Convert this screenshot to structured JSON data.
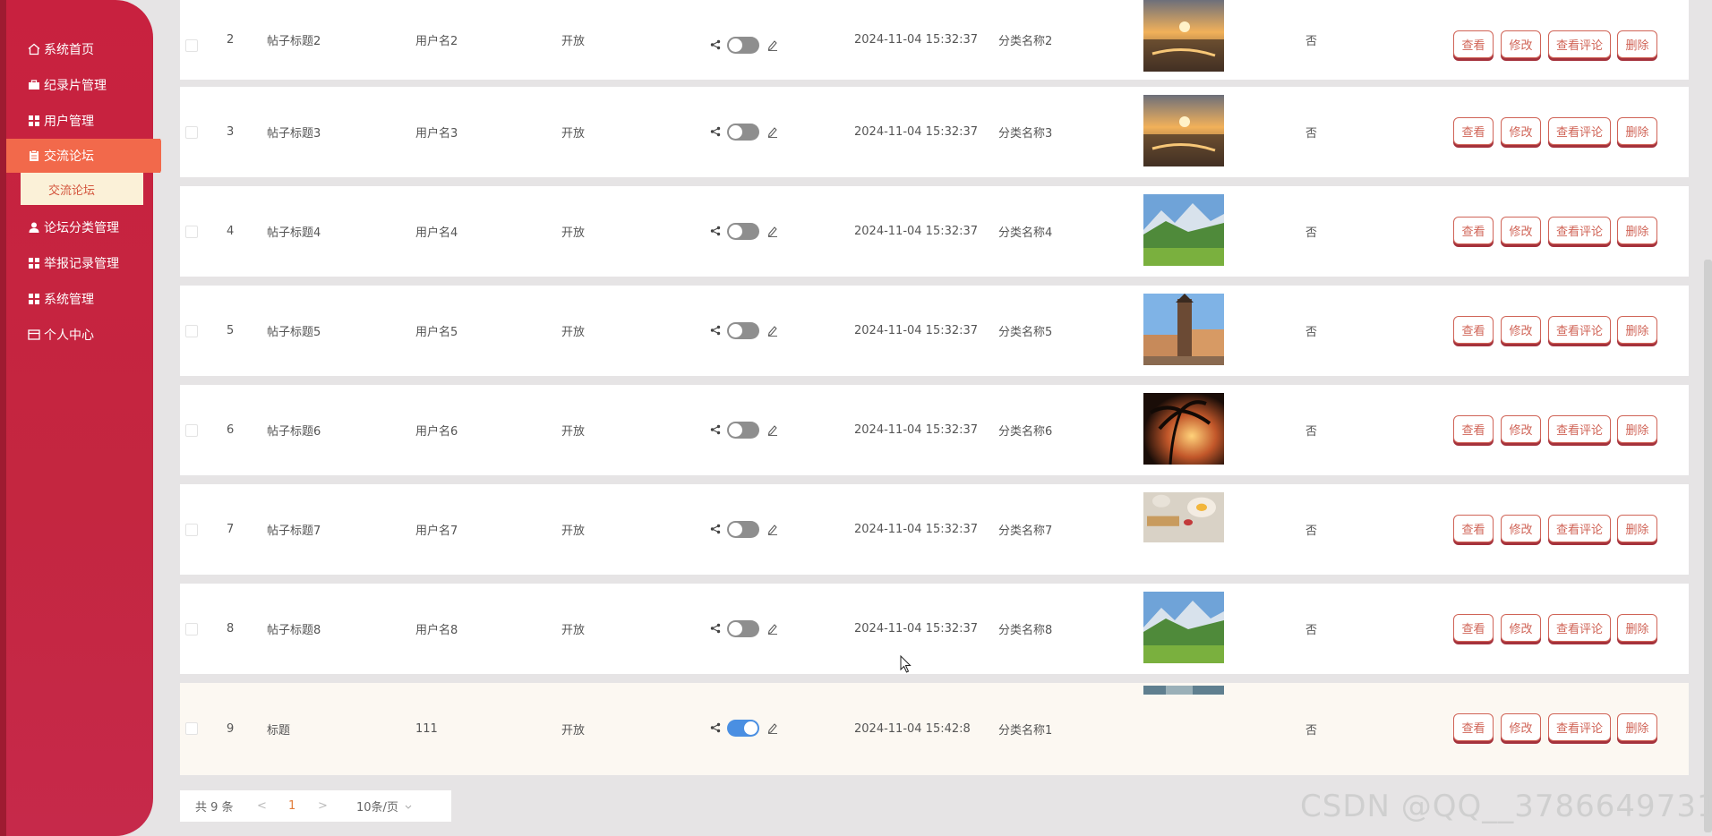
{
  "sidebar": {
    "items": [
      {
        "label": "系统首页",
        "icon": "home-icon"
      },
      {
        "label": "纪录片管理",
        "icon": "briefcase-icon"
      },
      {
        "label": "用户管理",
        "icon": "grid-icon"
      },
      {
        "label": "交流论坛",
        "icon": "clipboard-icon"
      },
      {
        "label": "论坛分类管理",
        "icon": "user-icon"
      },
      {
        "label": "举报记录管理",
        "icon": "grid-icon"
      },
      {
        "label": "系统管理",
        "icon": "grid-icon"
      },
      {
        "label": "个人中心",
        "icon": "card-icon"
      }
    ],
    "submenu": {
      "label": "交流论坛"
    }
  },
  "table": {
    "actions": {
      "view": "查看",
      "edit": "修改",
      "comments": "查看评论",
      "delete": "删除"
    },
    "rows": [
      {
        "index": "2",
        "title": "帖子标题2",
        "user": "用户名2",
        "status": "开放",
        "toggle_on": false,
        "time": "2024-11-04 15:32:37",
        "category": "分类名称2",
        "image": "sunset-sea",
        "flag": "否"
      },
      {
        "index": "3",
        "title": "帖子标题3",
        "user": "用户名3",
        "status": "开放",
        "toggle_on": false,
        "time": "2024-11-04 15:32:37",
        "category": "分类名称3",
        "image": "sunset-sea",
        "flag": "否"
      },
      {
        "index": "4",
        "title": "帖子标题4",
        "user": "用户名4",
        "status": "开放",
        "toggle_on": false,
        "time": "2024-11-04 15:32:37",
        "category": "分类名称4",
        "image": "mountain-meadow",
        "flag": "否"
      },
      {
        "index": "5",
        "title": "帖子标题5",
        "user": "用户名5",
        "status": "开放",
        "toggle_on": false,
        "time": "2024-11-04 15:32:37",
        "category": "分类名称5",
        "image": "old-town-tower",
        "flag": "否"
      },
      {
        "index": "6",
        "title": "帖子标题6",
        "user": "用户名6",
        "status": "开放",
        "toggle_on": false,
        "time": "2024-11-04 15:32:37",
        "category": "分类名称6",
        "image": "palm-sunset",
        "flag": "否"
      },
      {
        "index": "7",
        "title": "帖子标题7",
        "user": "用户名7",
        "status": "开放",
        "toggle_on": false,
        "time": "2024-11-04 15:32:37",
        "category": "分类名称7",
        "image": "breakfast-table",
        "flag": "否"
      },
      {
        "index": "8",
        "title": "帖子标题8",
        "user": "用户名8",
        "status": "开放",
        "toggle_on": false,
        "time": "2024-11-04 15:32:37",
        "category": "分类名称8",
        "image": "mountain-meadow",
        "flag": "否"
      },
      {
        "index": "9",
        "title": "标题",
        "user": "111",
        "status": "开放",
        "toggle_on": true,
        "time": "2024-11-04 15:42:8",
        "category": "分类名称1",
        "image": "partial-strip",
        "flag": "否"
      }
    ]
  },
  "pagination": {
    "total": "共 9 条",
    "prev": "<",
    "page": "1",
    "next": ">",
    "page_size": "10条/页"
  },
  "watermark": "CSDN @QQ__3786649731",
  "colors": {
    "sidebar": "#c8213f",
    "active": "#f2694b",
    "submenu_bg": "#fbf1d8",
    "button": "#d06457",
    "toggle_on": "#4a8fe2",
    "toggle_off": "#8e8e8e"
  }
}
